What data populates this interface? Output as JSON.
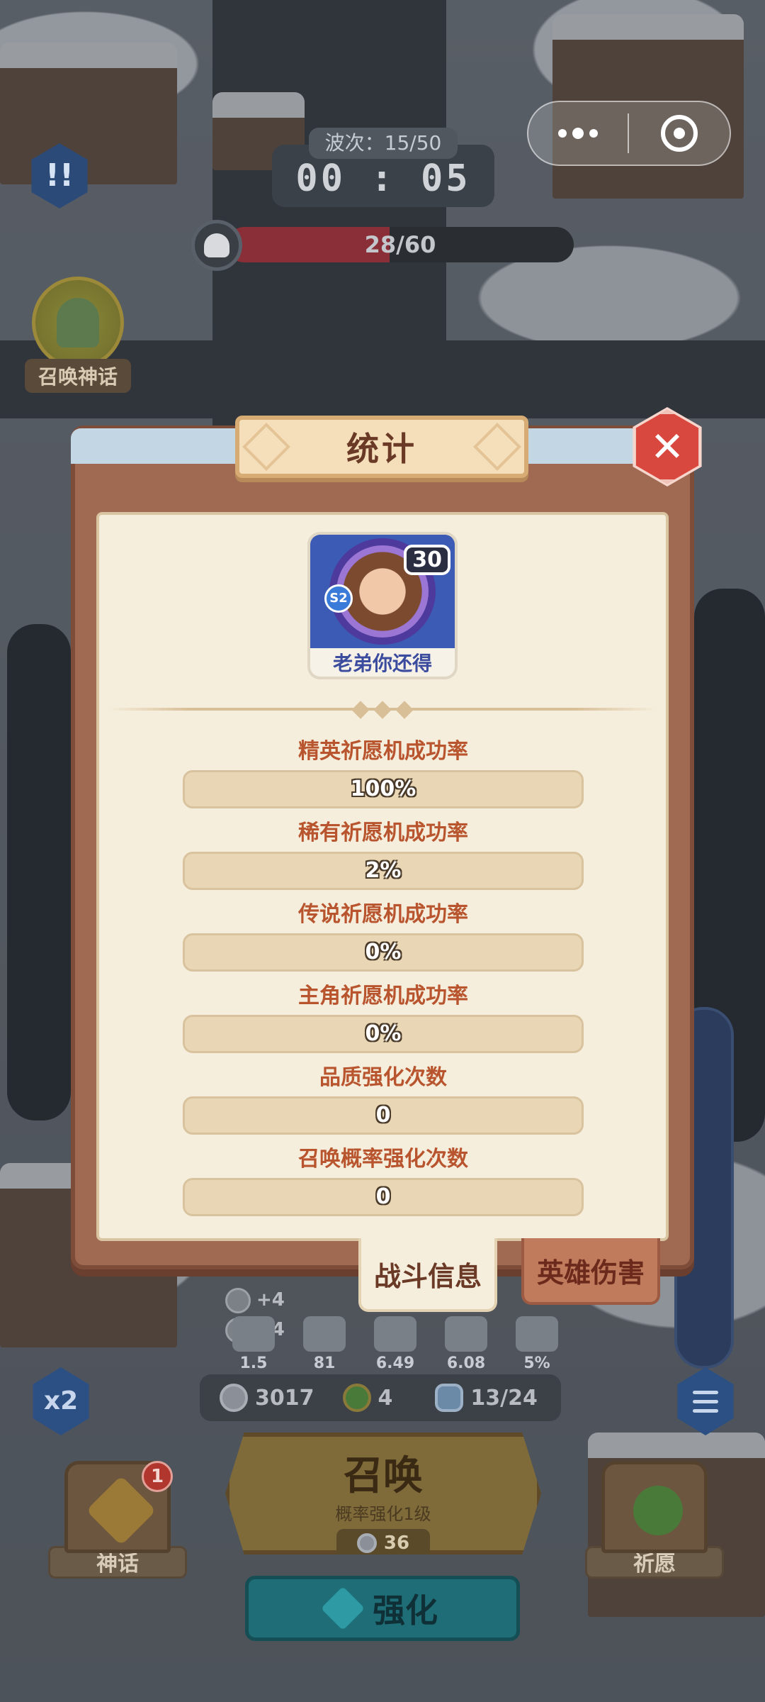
{
  "hud": {
    "wave_label": "波次：15/50",
    "timer": "00 : 05",
    "enemy_count": "28/60",
    "enemy_fill": 0.47,
    "alert_label": "!!",
    "myth_summon_label": "召唤神话"
  },
  "modal": {
    "title": "统计",
    "close_label": "✕",
    "player": {
      "name": "老弟你还得",
      "level": "30",
      "season": "S2"
    },
    "stats": [
      {
        "label": "精英祈愿机成功率",
        "value": "100%"
      },
      {
        "label": "稀有祈愿机成功率",
        "value": "2%"
      },
      {
        "label": "传说祈愿机成功率",
        "value": "0%"
      },
      {
        "label": "主角祈愿机成功率",
        "value": "0%"
      },
      {
        "label": "品质强化次数",
        "value": "0"
      },
      {
        "label": "召唤概率强化次数",
        "value": "0"
      }
    ],
    "tabs": {
      "battle_info": "战斗信息",
      "hero_damage": "英雄伤害"
    }
  },
  "bottom": {
    "plus_tags": [
      "+4",
      "+4"
    ],
    "buffs": [
      "1.5",
      "81",
      "6.49",
      "6.08",
      "5%"
    ],
    "resources": {
      "coins": "3017",
      "clovers": "4",
      "population": "13/24"
    },
    "speed_label": "x2",
    "summon": {
      "title": "召唤",
      "subtitle": "概率强化1级",
      "cost": "36"
    },
    "strengthen_label": "强化",
    "myth_slot": {
      "label": "神话",
      "badge": "1"
    },
    "wish_slot": {
      "label": "祈愿"
    }
  }
}
